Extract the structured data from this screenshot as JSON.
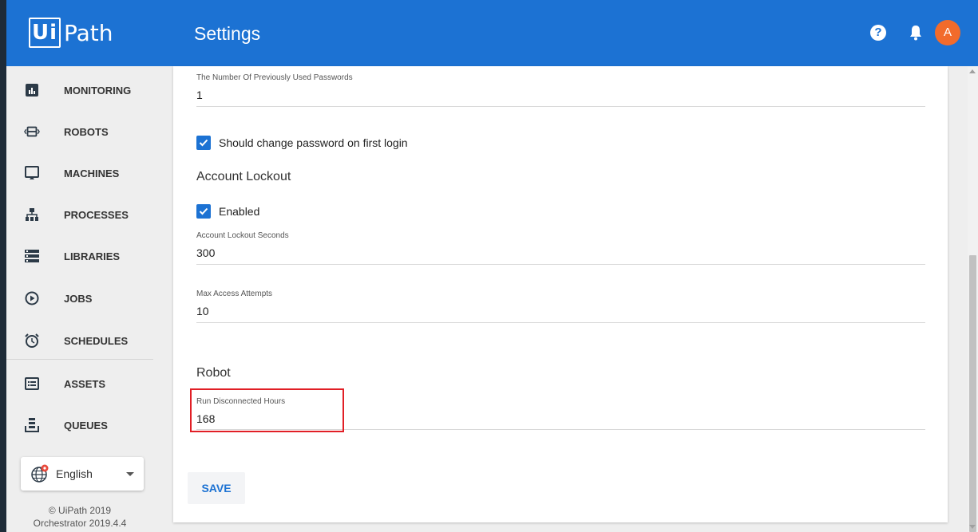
{
  "header": {
    "logo_box": "Ui",
    "logo_rest": "Path",
    "title": "Settings",
    "help_icon": "?",
    "avatar_initial": "A",
    "colors": {
      "bar": "#1c72d3",
      "avatar": "#f26b2b"
    }
  },
  "sidebar": {
    "items": [
      {
        "label": "MONITORING",
        "icon": "chart-icon"
      },
      {
        "label": "ROBOTS",
        "icon": "robot-icon"
      },
      {
        "label": "MACHINES",
        "icon": "monitor-icon"
      },
      {
        "label": "PROCESSES",
        "icon": "hierarchy-icon"
      },
      {
        "label": "LIBRARIES",
        "icon": "list-icon"
      },
      {
        "label": "JOBS",
        "icon": "play-circle-icon"
      },
      {
        "label": "SCHEDULES",
        "icon": "alarm-clock-icon"
      },
      {
        "label": "ASSETS",
        "icon": "assets-icon"
      },
      {
        "label": "QUEUES",
        "icon": "queue-icon"
      }
    ],
    "language": "English",
    "footer_line1": "© UiPath 2019",
    "footer_line2": "Orchestrator 2019.4.4"
  },
  "form": {
    "prev_passwords": {
      "label": "The Number Of Previously Used Passwords",
      "value": "1"
    },
    "change_on_first_login": {
      "label": "Should change password on first login",
      "checked": true
    },
    "account_lockout_title": "Account Lockout",
    "enabled": {
      "label": "Enabled",
      "checked": true
    },
    "lockout_seconds": {
      "label": "Account Lockout Seconds",
      "value": "300"
    },
    "max_attempts": {
      "label": "Max Access Attempts",
      "value": "10"
    },
    "robot_title": "Robot",
    "run_disconnected": {
      "label": "Run Disconnected Hours",
      "value": "168"
    },
    "save_label": "SAVE"
  }
}
